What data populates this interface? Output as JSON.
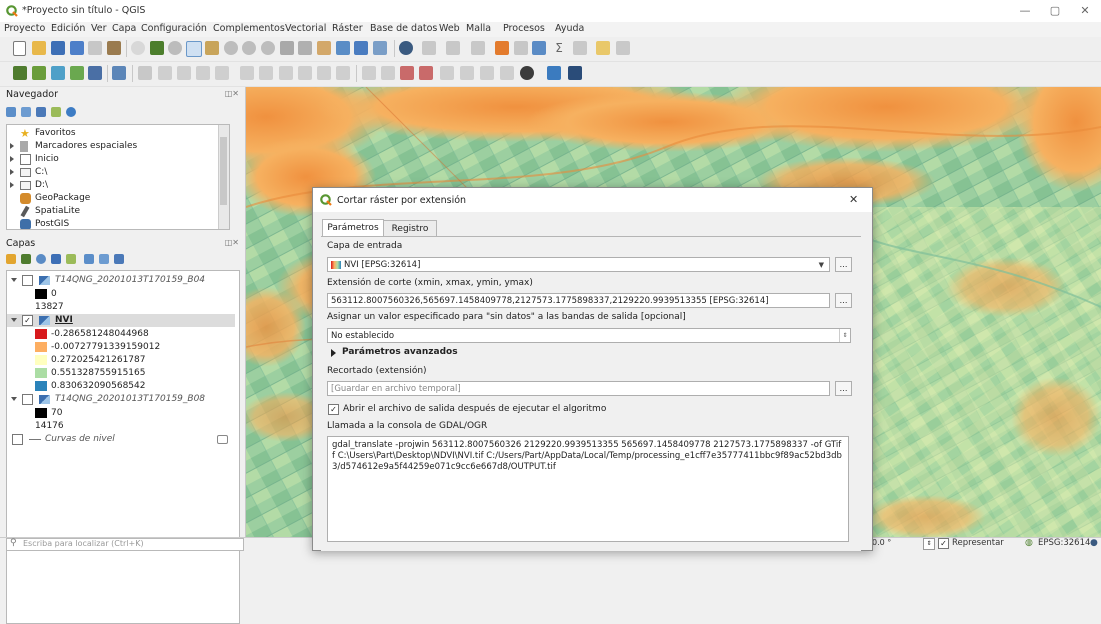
{
  "window": {
    "title": "*Proyecto sin título - QGIS",
    "minimize": "—",
    "restore": "▢",
    "close": "✕"
  },
  "menu": [
    "Proyecto",
    "Edición",
    "Ver",
    "Capa",
    "Configuración",
    "Complementos",
    "Vectorial",
    "Ráster",
    "Base de datos",
    "Web",
    "Malla",
    "Procesos",
    "Ayuda"
  ],
  "navigator": {
    "title": "Navegador",
    "items": [
      {
        "label": "Favoritos",
        "icon": "star-icon",
        "expandable": false
      },
      {
        "label": "Marcadores espaciales",
        "icon": "bookmark-icon",
        "expandable": true
      },
      {
        "label": "Inicio",
        "icon": "home-folder-icon",
        "expandable": true
      },
      {
        "label": "C:\\",
        "icon": "drive-icon",
        "expandable": true
      },
      {
        "label": "D:\\",
        "icon": "drive-icon",
        "expandable": true
      },
      {
        "label": "GeoPackage",
        "icon": "geopackage-icon",
        "expandable": false
      },
      {
        "label": "SpatiaLite",
        "icon": "spatialite-icon",
        "expandable": false
      },
      {
        "label": "PostGIS",
        "icon": "postgis-icon",
        "expandable": false
      }
    ]
  },
  "layers": {
    "title": "Capas",
    "items": [
      {
        "type": "layer",
        "name": "T14QNG_20201013T170159_B04",
        "checked": false,
        "italic": true
      },
      {
        "type": "legend",
        "color": "#000000",
        "label": "0"
      },
      {
        "type": "legend",
        "color": "",
        "label": "13827"
      },
      {
        "type": "layer",
        "name": "NVI",
        "checked": true,
        "italic": false
      },
      {
        "type": "legend",
        "color": "#d7191c",
        "label": "-0.286581248044968"
      },
      {
        "type": "legend",
        "color": "#fdae61",
        "label": "-0.00727791339159012"
      },
      {
        "type": "legend",
        "color": "#ffffbf",
        "label": "0.272025421261787"
      },
      {
        "type": "legend",
        "color": "#abdda4",
        "label": "0.551328755915165"
      },
      {
        "type": "legend",
        "color": "#2b83ba",
        "label": "0.830632090568542"
      },
      {
        "type": "layer",
        "name": "T14QNG_20201013T170159_B08",
        "checked": false,
        "italic": true
      },
      {
        "type": "legend",
        "color": "#000000",
        "label": "70"
      },
      {
        "type": "legend",
        "color": "",
        "label": "14176"
      },
      {
        "type": "group",
        "name": "Curvas de nivel",
        "checked": false,
        "italic": true
      }
    ]
  },
  "dialog": {
    "title": "Cortar ráster por extensión",
    "tabs": [
      "Parámetros",
      "Registro"
    ],
    "input_layer_label": "Capa de entrada",
    "input_layer_value": "NVI [EPSG:32614]",
    "extent_label": "Extensión de corte (xmin, xmax, ymin, ymax)",
    "extent_value": "563112.8007560326,565697.1458409778,2127573.1775898337,2129220.9939513355 [EPSG:32614]",
    "nodata_label": "Asignar un valor especificado para \"sin datos\" a las bandas de salida [opcional]",
    "nodata_value": "No establecido",
    "advanced_label": "Parámetros avanzados",
    "clipped_label": "Recortado (extensión)",
    "clipped_placeholder": "[Guardar en archivo temporal]",
    "open_output_label": "Abrir el archivo de salida después de ejecutar el algoritmo",
    "open_output_checked": true,
    "console_label": "Llamada a la consola de GDAL/OGR",
    "console_text": "gdal_translate -projwin 563112.8007560326 2129220.9939513355 565697.1458409778 2127573.1775898337 -of GTiff C:\\Users\\Part\\Desktop\\NDVI\\NVI.tif C:/Users/Part/AppData/Local/Temp/processing_e1cff7e35777411bbc9f89ac52bd3db3/d574612e9a5f44259e071c9cc6e667d8/OUTPUT.tif",
    "ellipsis": "…",
    "close": "✕"
  },
  "statusbar": {
    "search_placeholder": "Escriba para localizar (Ctrl+K)",
    "rotation": "0.0 °",
    "render_label": "Representar",
    "crs": "EPSG:32614"
  },
  "colors": {
    "ndvi_low": "#d7191c",
    "ndvi_mid_low": "#fdae61",
    "ndvi_mid": "#ffffbf",
    "ndvi_mid_high": "#abdda4",
    "ndvi_high": "#2b83ba",
    "qgis_green": "#589632"
  }
}
